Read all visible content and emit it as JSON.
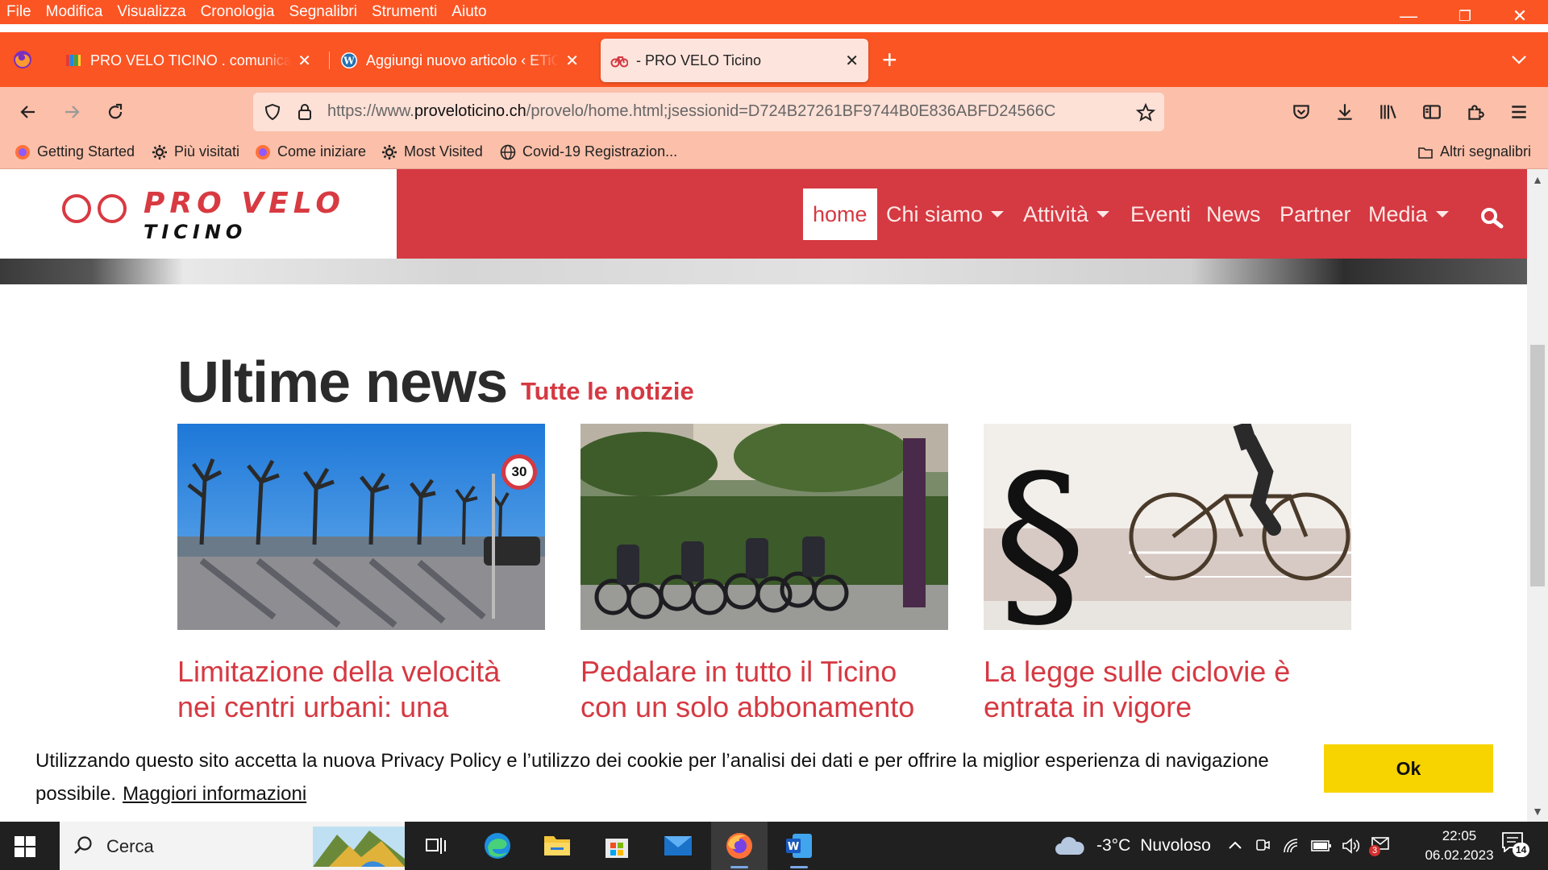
{
  "browser": {
    "menu": [
      "File",
      "Modifica",
      "Visualizza",
      "Cronologia",
      "Segnalibri",
      "Strumenti",
      "Aiuto"
    ],
    "menu_mnemonics": [
      "F",
      "M",
      "V",
      "C",
      "S",
      "S",
      "A"
    ],
    "window_controls": {
      "minimize": "—",
      "restore": "❐",
      "close": "✕"
    },
    "tabs": [
      {
        "label": "PRO VELO TICINO . comunicato",
        "active": false,
        "favicon": "colorful-grid-icon"
      },
      {
        "label": "Aggiungi nuovo articolo ‹ ETiCi",
        "active": false,
        "favicon": "wordpress-icon"
      },
      {
        "label": "- PRO VELO Ticino",
        "active": true,
        "favicon": "bike-icon"
      }
    ],
    "new_tab": "+",
    "url": {
      "prefix": "https://www.",
      "domain": "proveloticino.ch",
      "path": "/provelo/home.html;jsessionid=D724B27261BF9744B0E836ABFD24566C"
    },
    "bookmarks": [
      {
        "label": "Getting Started",
        "icon": "firefox-icon"
      },
      {
        "label": "Più visitati",
        "icon": "gear-icon"
      },
      {
        "label": "Come iniziare",
        "icon": "firefox-icon"
      },
      {
        "label": "Most Visited",
        "icon": "gear-icon"
      },
      {
        "label": "Covid-19 Registrazion...",
        "icon": "globe-icon"
      }
    ],
    "other_bookmarks": "Altri segnalibri"
  },
  "site": {
    "logo": {
      "line1": "PRO VELO",
      "line2": "TICINO"
    },
    "nav": [
      {
        "label": "home",
        "active": true,
        "dropdown": false
      },
      {
        "label": "Chi siamo",
        "active": false,
        "dropdown": true
      },
      {
        "label": "Attività",
        "active": false,
        "dropdown": true
      },
      {
        "label": "Eventi",
        "active": false,
        "dropdown": false
      },
      {
        "label": "News",
        "active": false,
        "dropdown": false
      },
      {
        "label": "Partner",
        "active": false,
        "dropdown": false
      },
      {
        "label": "Media",
        "active": false,
        "dropdown": true
      }
    ],
    "news": {
      "heading": "Ultime news",
      "all_link": "Tutte le notizie",
      "cards": [
        {
          "title": "Limitazione della velocità nei centri urbani: una",
          "image": "lakeside-trees-photo"
        },
        {
          "title": "Pedalare in tutto il Ticino con un solo abbonamento",
          "image": "bike-sharing-station-photo"
        },
        {
          "title": "La legge sulle ciclovie è entrata in vigore",
          "image": "paragraph-cyclist-photo"
        }
      ]
    },
    "cookie": {
      "text": "Utilizzando questo sito accetta la nuova Privacy Policy e l’utilizzo dei cookie per l’analisi dei dati e per offrire la miglior esperienza di navigazione possibile.",
      "more": "Maggiori informazioni",
      "ok": "Ok"
    },
    "speed_sign": "30",
    "colors": {
      "brand_red": "#d53942",
      "firefox_orange": "#fb5524",
      "cookie_button": "#f7d300"
    }
  },
  "taskbar": {
    "search": "Cerca",
    "weather": {
      "temp": "-3°C",
      "condition": "Nuvoloso"
    },
    "time": "22:05",
    "date": "06.02.2023",
    "notifications": "14",
    "mail_badge": "3"
  }
}
